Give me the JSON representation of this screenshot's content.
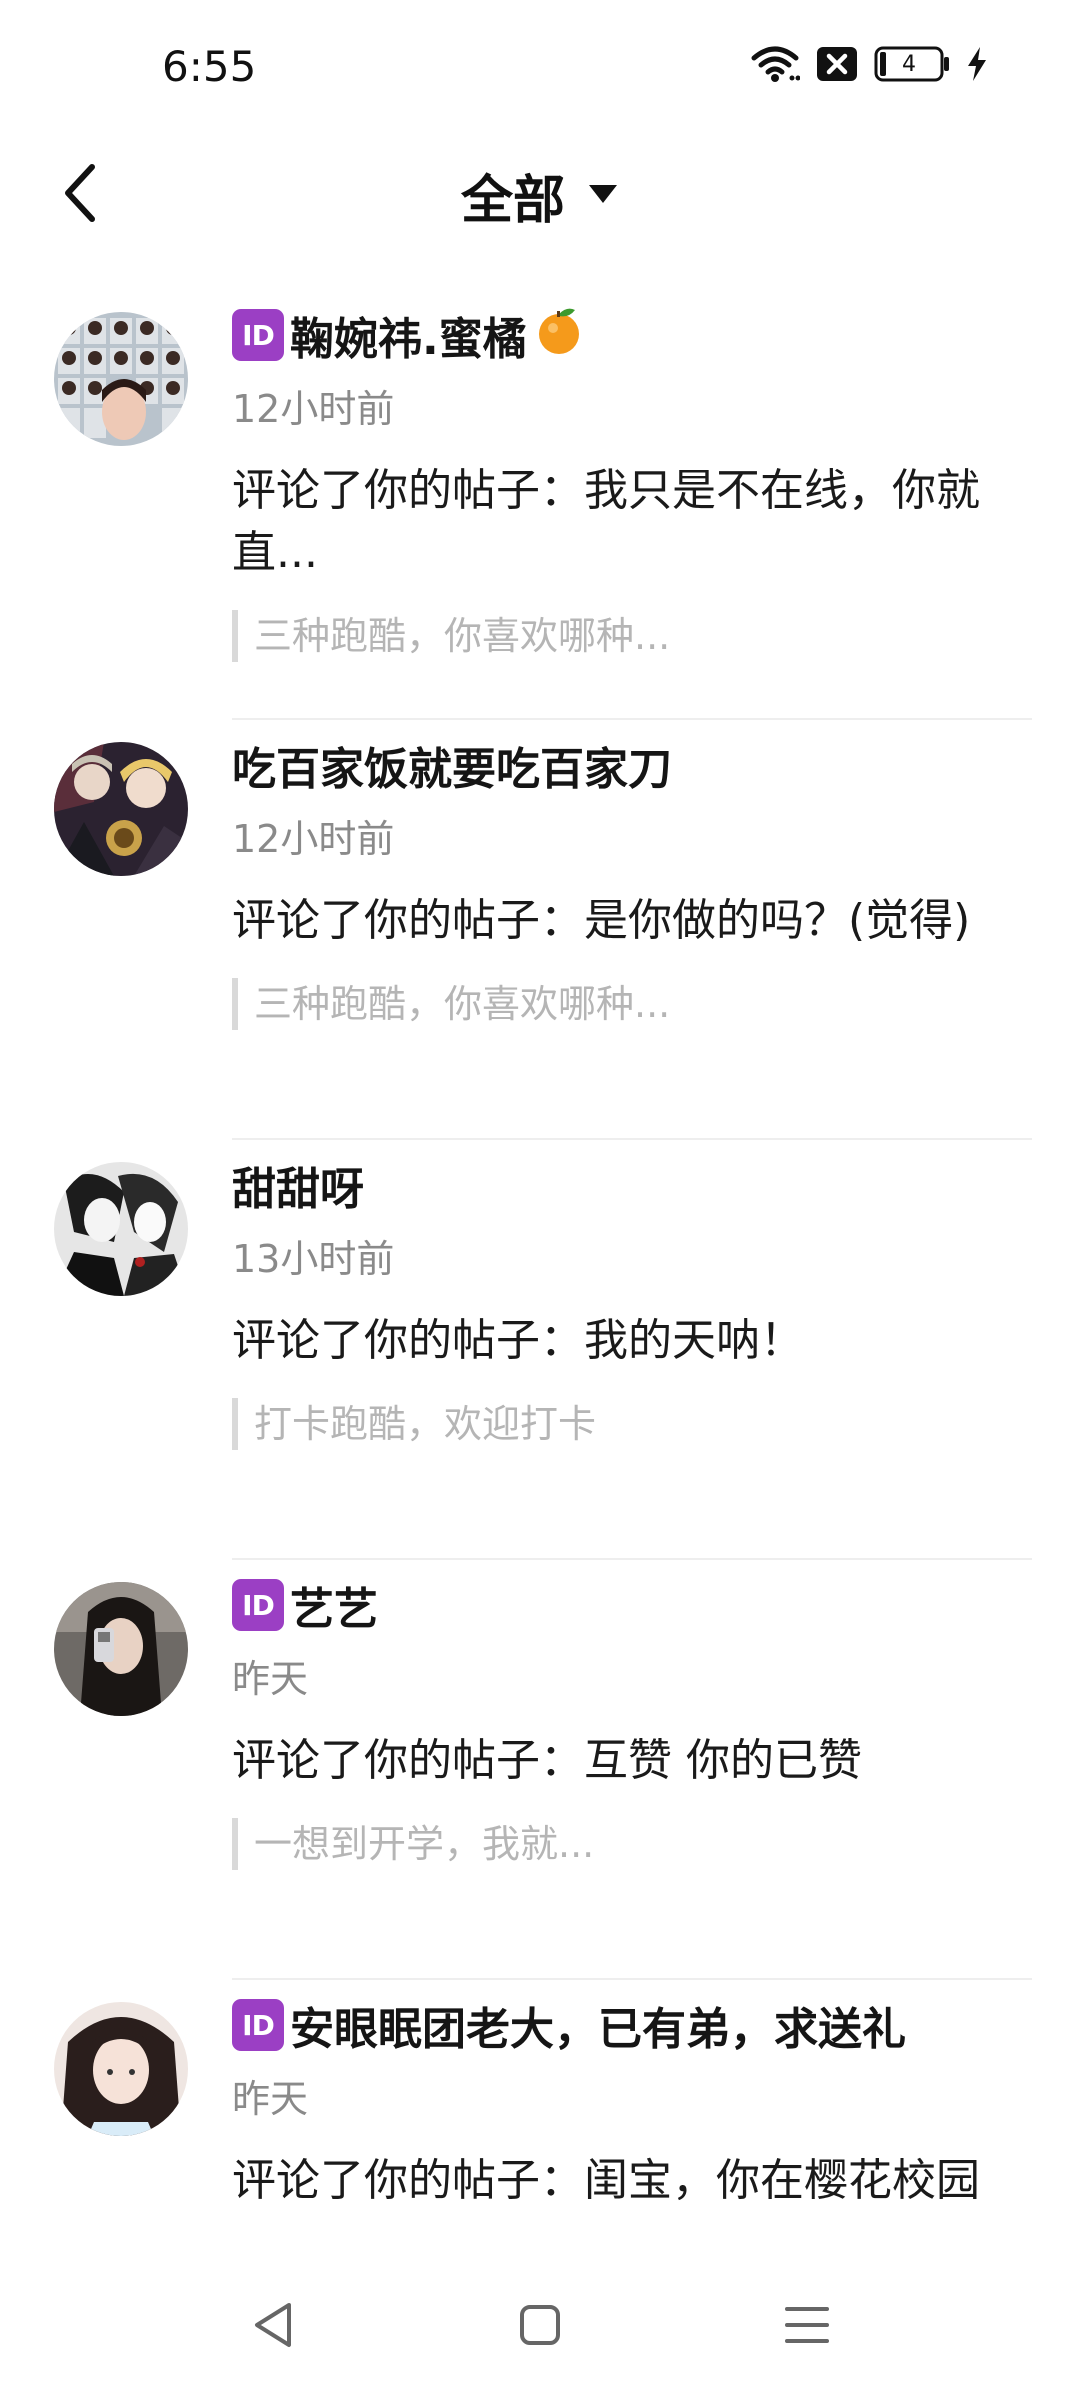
{
  "status_bar": {
    "time": "6:55",
    "battery": "4",
    "icons": [
      "wifi-icon",
      "notification-x-icon",
      "battery-icon",
      "charging-bolt-icon"
    ]
  },
  "nav": {
    "title": "全部",
    "back_icon": "chevron-left-icon",
    "dropdown_icon": "caret-down-icon"
  },
  "items": [
    {
      "badge": "ID",
      "name": "鞠婉祎.蜜橘",
      "name_suffix_icon": "orange-emoji-icon",
      "time": "12小时前",
      "comment": "评论了你的帖子：我只是不在线，你就直...",
      "quote": "三种跑酷，你喜欢哪种..."
    },
    {
      "badge": "",
      "name": "吃百家饭就要吃百家刀",
      "time": "12小时前",
      "comment": "评论了你的帖子：是你做的吗？(觉得)",
      "quote": "三种跑酷，你喜欢哪种..."
    },
    {
      "badge": "",
      "name": "甜甜呀",
      "time": "13小时前",
      "comment": "评论了你的帖子：我的天呐！",
      "quote": "打卡跑酷，欢迎打卡"
    },
    {
      "badge": "ID",
      "name": "艺艺",
      "time": "昨天",
      "comment": "评论了你的帖子：互赞 你的已赞",
      "quote": "一想到开学，我就..."
    },
    {
      "badge": "ID",
      "name": "安眼眠团老大，已有弟，求送礼",
      "time": "昨天",
      "comment": "评论了你的帖子：闺宝，你在樱花校园",
      "quote": ""
    }
  ],
  "bottom_nav": {
    "icons": [
      "back-triangle-icon",
      "home-square-icon",
      "menu-lines-icon"
    ]
  }
}
